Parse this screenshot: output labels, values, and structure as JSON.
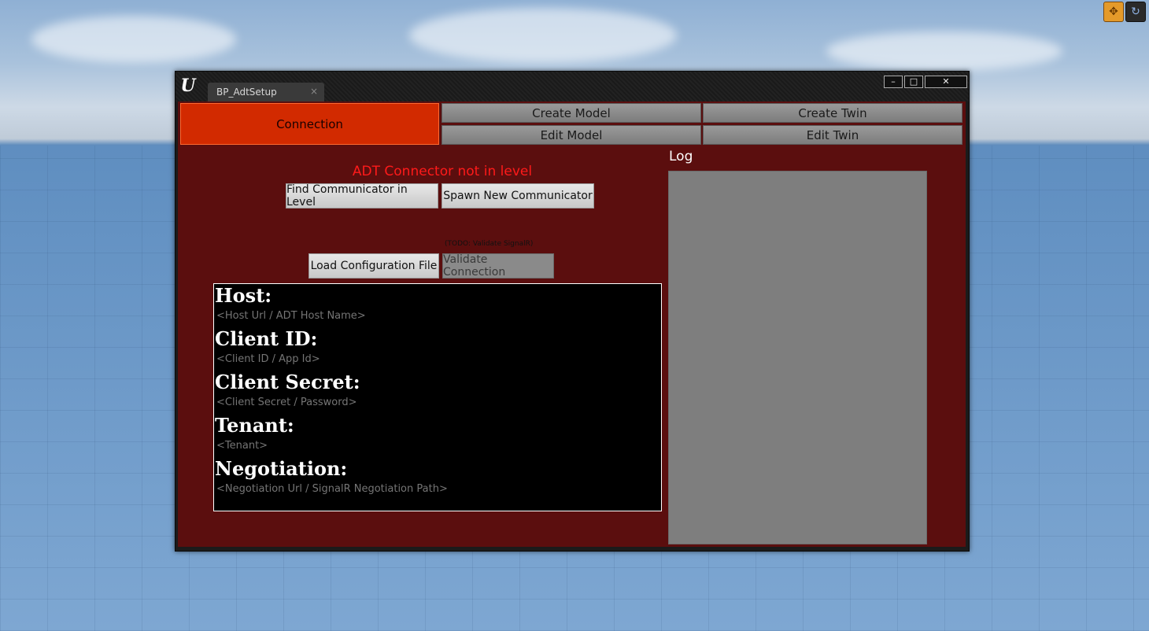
{
  "window": {
    "tab_title": "BP_AdtSetup",
    "tab_close": "×",
    "minimize": "–",
    "maximize": "□",
    "close": "✕"
  },
  "nav": {
    "connection": "Connection",
    "create_model": "Create Model",
    "create_twin": "Create Twin",
    "edit_model": "Edit Model",
    "edit_twin": "Edit Twin"
  },
  "main": {
    "status": "ADT Connector not in level",
    "find_communicator": "Find Communicator in Level",
    "spawn_communicator": "Spawn New Communicator",
    "todo_note": "(TODO: Validate SignalR)",
    "load_config": "Load Configuration File",
    "validate_connection": "Validate Connection"
  },
  "form": {
    "host_label": "Host:",
    "host_placeholder": "<Host Url / ADT Host Name>",
    "client_id_label": "Client ID:",
    "client_id_placeholder": "<Client ID / App Id>",
    "client_secret_label": "Client Secret:",
    "client_secret_placeholder": "<Client Secret / Password>",
    "tenant_label": "Tenant:",
    "tenant_placeholder": "<Tenant>",
    "negotiation_label": "Negotiation:",
    "negotiation_placeholder": "<Negotiation Url / SignalR Negotiation Path>"
  },
  "log": {
    "title": "Log"
  },
  "colors": {
    "panel_bg": "#5b0e0e",
    "active_tab": "#d22a00",
    "status_text": "#ff1a1a"
  }
}
